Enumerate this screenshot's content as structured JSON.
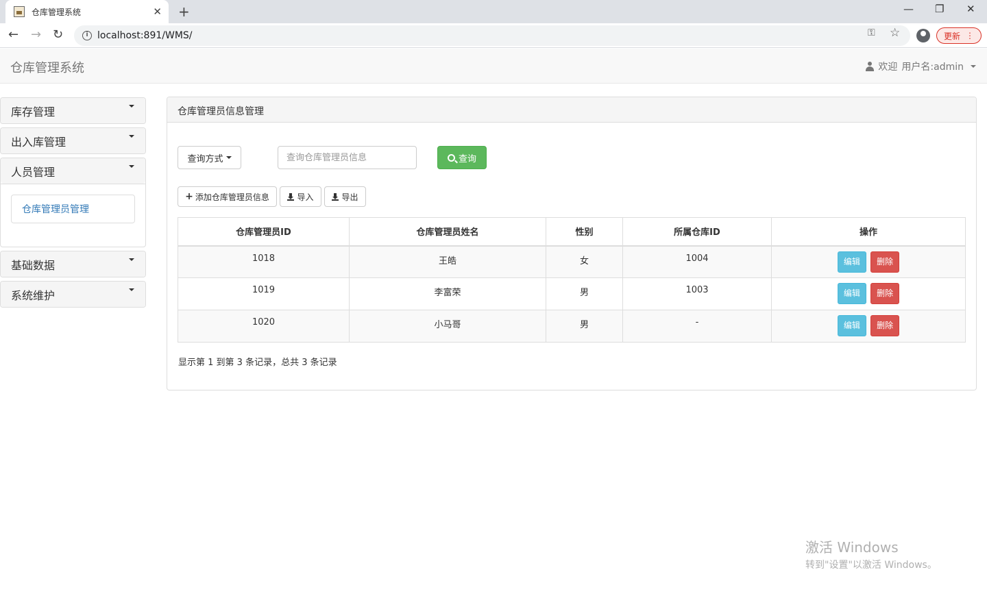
{
  "browser": {
    "tab_title": "仓库管理系统",
    "new_tab": "+",
    "tab_close": "✕",
    "url": "localhost:891/WMS/",
    "update_label": "更新",
    "minimize": "—",
    "maximize": "❐",
    "close": "✕",
    "back": "←",
    "forward": "→",
    "reload": "↻",
    "key_icon": "⚿",
    "star_icon": "☆",
    "menu_icon": "⋮"
  },
  "navbar": {
    "brand": "仓库管理系统",
    "welcome": "欢迎",
    "username": "用户名:admin"
  },
  "sidebar": {
    "panels": [
      {
        "label": "库存管理"
      },
      {
        "label": "出入库管理"
      },
      {
        "label": "人员管理",
        "sub_item": "仓库管理员管理"
      },
      {
        "label": "基础数据"
      },
      {
        "label": "系统维护"
      }
    ]
  },
  "main": {
    "panel_title": "仓库管理员信息管理",
    "query_mode_label": "查询方式",
    "search_placeholder": "查询仓库管理员信息",
    "search_button": "查询",
    "add_button": "添加仓库管理员信息",
    "import_button": "导入",
    "export_button": "导出",
    "table": {
      "headers": [
        "仓库管理员ID",
        "仓库管理员姓名",
        "性别",
        "所属仓库ID",
        "操作"
      ],
      "rows": [
        {
          "id": "1018",
          "name": "王皓",
          "sex": "女",
          "repo": "1004"
        },
        {
          "id": "1019",
          "name": "李富荣",
          "sex": "男",
          "repo": "1003"
        },
        {
          "id": "1020",
          "name": "小马哥",
          "sex": "男",
          "repo": "-"
        }
      ],
      "edit_label": "编辑",
      "delete_label": "删除"
    },
    "pager_info": "显示第 1 到第 3 条记录，总共 3 条记录"
  },
  "watermark": {
    "title": "激活 Windows",
    "subtitle": "转到\"设置\"以激活 Windows。"
  },
  "colors": {
    "success": "#5cb85c",
    "info": "#5bc0de",
    "danger": "#d9534f",
    "link": "#337ab7"
  }
}
